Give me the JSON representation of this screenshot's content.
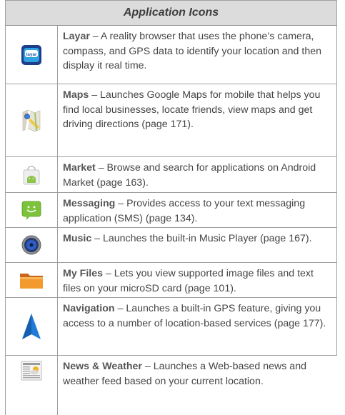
{
  "header": {
    "title": "Application Icons"
  },
  "rows": [
    {
      "name": "Layar",
      "sep": " – ",
      "desc": "A reality browser that uses the  phone’s camera, compass, and GPS data to identify your location and then display it real time.",
      "icon": "layar-icon"
    },
    {
      "name": "Maps",
      "sep": " – ",
      "desc": "Launches Google Maps for mobile that helps you find local businesses, locate friends, view maps and get driving directions (page 171).",
      "icon": "maps-icon"
    },
    {
      "name": "Market",
      "sep": " – ",
      "desc": "Browse and search for applications on Android Market (page 163).",
      "icon": "market-icon"
    },
    {
      "name": "Messaging",
      "sep": " – ",
      "desc": "Provides access to your text messaging application (SMS) (page 134).",
      "icon": "messaging-icon"
    },
    {
      "name": "Music",
      "sep": " – ",
      "desc": "Launches the built-in Music Player (page 167).",
      "icon": "music-icon"
    },
    {
      "name": "My Files",
      "sep": " – ",
      "desc": "Lets you view supported image files and text files on your microSD card (page 101).",
      "icon": "my-files-icon"
    },
    {
      "name": "Navigation",
      "sep": " – ",
      "desc": "Launches a built-in GPS feature, giving you access to a number of location-based services (page 177).",
      "icon": "navigation-icon"
    },
    {
      "name": "News & Weather",
      "sep": " – ",
      "desc": "Launches a Web-based news and weather feed based on your current location.",
      "icon": "news-weather-icon"
    }
  ]
}
